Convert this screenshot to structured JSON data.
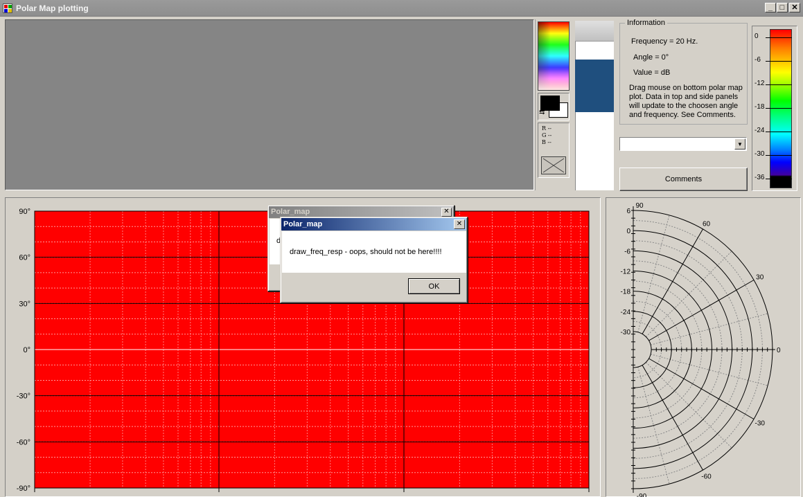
{
  "window": {
    "title": "Polar Map plotting",
    "controls": {
      "minimize": "_",
      "maximize": "□",
      "close": "✕"
    }
  },
  "color_picker": {
    "r_label": "R --",
    "g_label": "G --",
    "b_label": "B --"
  },
  "information": {
    "group_label": "Information",
    "frequency": "Frequency = 20 Hz.",
    "angle": "Angle = 0°",
    "value": "Value =  dB",
    "help": "Drag mouse on bottom polar map plot.  Data in top and side panels will update to the choosen angle and frequency.  See Comments."
  },
  "frequency_select": {
    "value": ""
  },
  "comments_button": "Comments",
  "colorbar": {
    "labels": [
      "0",
      "-6",
      "-12",
      "-18",
      "-24",
      "-30",
      "-36"
    ],
    "colors": [
      "#ff0000",
      "#ff8000",
      "#ffff00",
      "#00ff00",
      "#00ffff",
      "#0000ff",
      "#000000"
    ]
  },
  "map": {
    "fill_color": "#ff0000",
    "y_labels": [
      "90°",
      "60°",
      "30°",
      "0°",
      "-30°",
      "-60°",
      "-90°"
    ]
  },
  "polar": {
    "radial_labels": [
      "6",
      "0",
      "-6",
      "-12",
      "-18",
      "-24",
      "-30"
    ],
    "angle_labels": [
      "90",
      "60",
      "30",
      "0",
      "-30",
      "-60",
      "-90"
    ]
  },
  "dialog_back": {
    "title": "Polar_map",
    "close": "✕",
    "text_fragment": "d"
  },
  "dialog": {
    "title": "Polar_map",
    "close": "✕",
    "message": "draw_freq_resp - oops, should not be here!!!!",
    "ok_label": "OK"
  }
}
